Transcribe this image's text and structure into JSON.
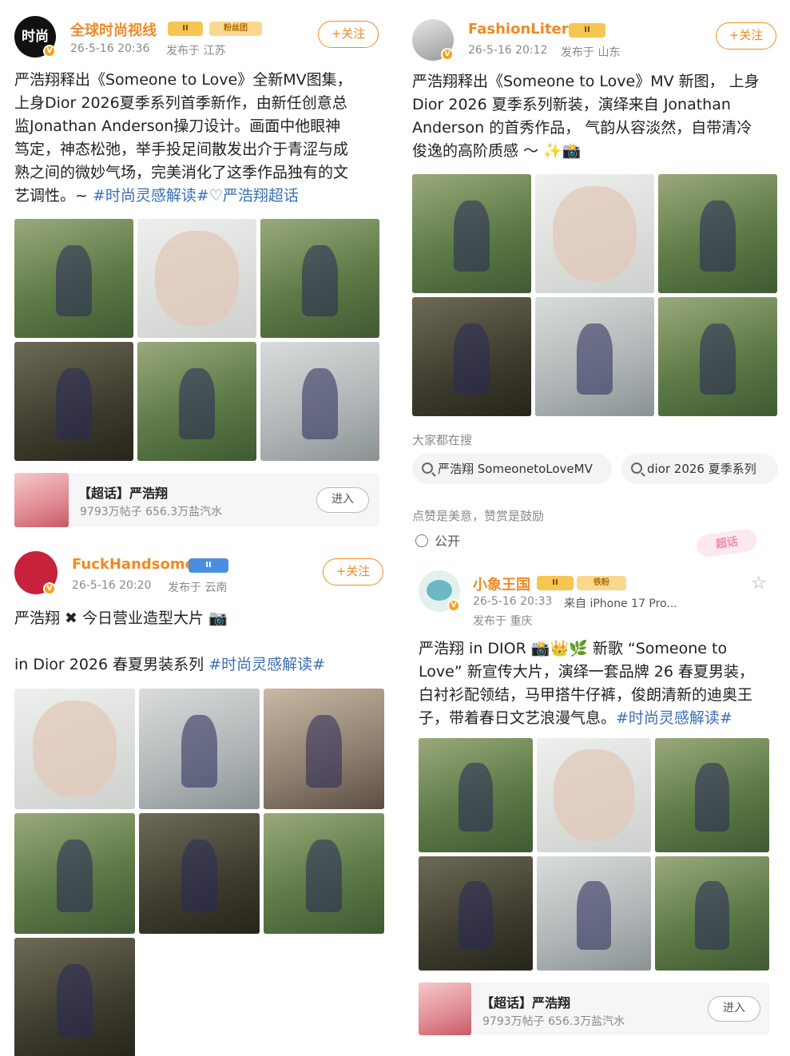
{
  "post1": {
    "avatar_text": "时尚",
    "username": "全球时尚视线",
    "level": "II",
    "badge": "粉丝团",
    "time": "26-5-16 20:36",
    "location": "发布于 江苏",
    "follow": "+关注",
    "text_lines": [
      "严浩翔释出《Someone to Love》全新MV图集，",
      "上身Dior 2026夏季系列首季新作，由新任创意总",
      "监Jonathan Anderson操刀设计。画面中他眼神",
      "笃定，神态松弛，举手投足间散发出介于青涩与成",
      "熟之间的微妙气场，完美消化了这季作品独有的文"
    ],
    "text_last_plain": "艺调性。~ ",
    "tag1": "#时尚灵感解读#",
    "tag2": "♡严浩翔超话",
    "card": {
      "title": "【超话】严浩翔",
      "sub": "9793万帖子 656.3万盐汽水",
      "enter": "进入"
    }
  },
  "post2": {
    "username": "FashionLitera",
    "level": "II",
    "time": "26-5-16 20:12",
    "location": "发布于 山东",
    "follow": "+关注",
    "text_lines": [
      "严浩翔释出《Someone to Love》MV 新图， 上身",
      "Dior 2026 夏季系列新装，演绎来自 Jonathan",
      "Anderson 的首秀作品， 气韵从容淡然，自带清冷",
      "俊逸的高阶质感 ～ ✨📸"
    ],
    "search_label": "大家都在搜",
    "chips": [
      "严浩翔 SomeonetoLoveMV",
      "dior 2026 夏季系列"
    ],
    "like_note": "点赞是美意，赞赏是鼓励",
    "visibility": "公开"
  },
  "post3": {
    "username": "FuckHandsome",
    "level": "II",
    "time": "26-5-16 20:20",
    "location": "发布于 云南",
    "follow": "+关注",
    "line1": "严浩翔 ✖ 今日营业造型大片 📷",
    "line2_plain": "in Dior 2026 春夏男装系列 ",
    "line2_tag": "#时尚灵感解读#"
  },
  "post4": {
    "username": "小象王国",
    "level": "II",
    "badge": "铁粉",
    "time": "26-5-16 20:33",
    "source": "来自 iPhone 17 Pro...",
    "location": "发布于 重庆",
    "text_lines": [
      "严浩翔 in DIOR 📸👑🌿  新歌 “Someone to",
      "Love” 新宣传大片，演绎一套品牌 26 春夏男装，",
      "白衬衫配领结，马甲搭牛仔裤，俊朗清新的迪奥王"
    ],
    "text_last_plain": "子，带着春日文艺浪漫气息。",
    "text_last_tag": "#时尚灵感解读#",
    "card": {
      "title": "【超话】严浩翔",
      "sub": "9793万帖子 656.3万盐汽水",
      "enter": "进入"
    }
  },
  "super_topic_sticker": "超话",
  "colors": {
    "accent": "#f08a24",
    "link": "#3a6fb5",
    "meta": "#8a8a8a",
    "vip": "#f7a21b"
  }
}
